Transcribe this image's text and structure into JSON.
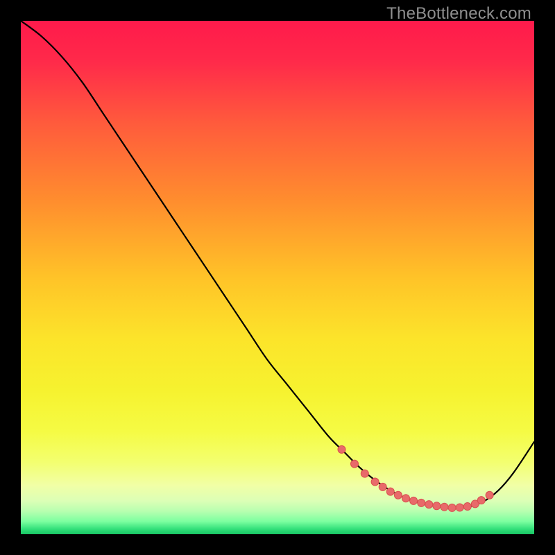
{
  "watermark": "TheBottleneck.com",
  "colors": {
    "background": "#000000",
    "gradient_stops": [
      {
        "offset": 0.0,
        "color": "#ff1a4b"
      },
      {
        "offset": 0.08,
        "color": "#ff2a4a"
      },
      {
        "offset": 0.2,
        "color": "#ff5b3c"
      },
      {
        "offset": 0.35,
        "color": "#ff8d2e"
      },
      {
        "offset": 0.5,
        "color": "#ffc328"
      },
      {
        "offset": 0.62,
        "color": "#fce42a"
      },
      {
        "offset": 0.72,
        "color": "#f6f22f"
      },
      {
        "offset": 0.8,
        "color": "#f5fb44"
      },
      {
        "offset": 0.86,
        "color": "#f3ff70"
      },
      {
        "offset": 0.905,
        "color": "#f1ffa6"
      },
      {
        "offset": 0.935,
        "color": "#dcffb6"
      },
      {
        "offset": 0.955,
        "color": "#b8ffb0"
      },
      {
        "offset": 0.975,
        "color": "#7dffa0"
      },
      {
        "offset": 0.99,
        "color": "#32e07a"
      },
      {
        "offset": 1.0,
        "color": "#18c463"
      }
    ],
    "curve": "#000000",
    "marker_fill": "#e86a6a",
    "marker_stroke": "#d94f4f"
  },
  "chart_data": {
    "type": "line",
    "title": "",
    "xlabel": "",
    "ylabel": "",
    "xlim": [
      0,
      100
    ],
    "ylim": [
      0,
      100
    ],
    "series": [
      {
        "name": "curve",
        "x": [
          0,
          4,
          8,
          12,
          16,
          20,
          24,
          28,
          32,
          36,
          40,
          44,
          48,
          52,
          56,
          60,
          63,
          66,
          69,
          72,
          75,
          78,
          81,
          84,
          87,
          90,
          93,
          96,
          100
        ],
        "y": [
          100,
          97,
          93,
          88,
          82,
          76,
          70,
          64,
          58,
          52,
          46,
          40,
          34,
          29,
          24,
          19,
          16,
          13,
          10.5,
          8.5,
          7,
          6,
          5.4,
          5.1,
          5.3,
          6.3,
          8.5,
          12,
          18
        ]
      }
    ],
    "markers": {
      "name": "highlight-points",
      "x": [
        62.5,
        65,
        67,
        69,
        70.5,
        72,
        73.5,
        75,
        76.5,
        78,
        79.5,
        81,
        82.5,
        84,
        85.5,
        87,
        88.5,
        89.7,
        91.3
      ],
      "y": [
        16.5,
        13.7,
        11.8,
        10.2,
        9.2,
        8.3,
        7.6,
        7.0,
        6.5,
        6.1,
        5.8,
        5.5,
        5.3,
        5.15,
        5.2,
        5.4,
        5.9,
        6.6,
        7.6
      ]
    }
  }
}
